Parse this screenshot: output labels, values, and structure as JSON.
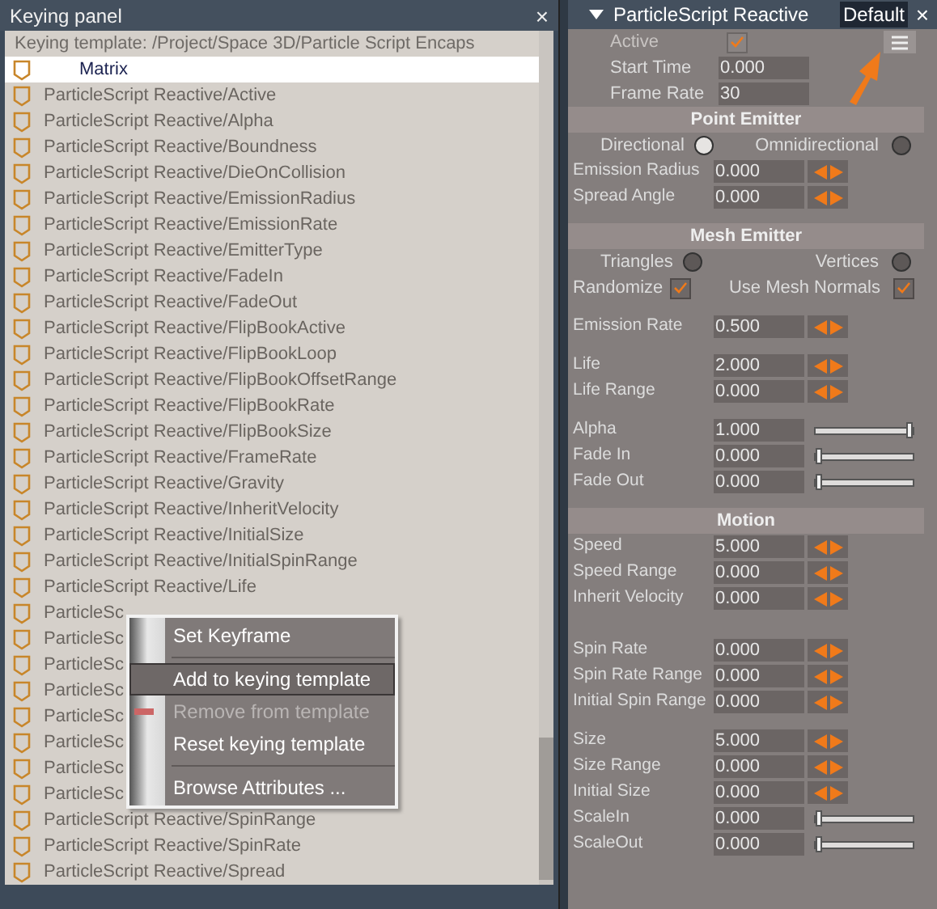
{
  "keying_panel": {
    "title": "Keying panel",
    "close": "×",
    "template": "Keying template: /Project/Space 3D/Particle Script Encaps",
    "rows": [
      {
        "label": "Matrix",
        "selected": true
      },
      {
        "label": "ParticleScript Reactive/Active",
        "selected": false
      },
      {
        "label": "ParticleScript Reactive/Alpha",
        "selected": false
      },
      {
        "label": "ParticleScript Reactive/Boundness",
        "selected": false
      },
      {
        "label": "ParticleScript Reactive/DieOnCollision",
        "selected": false
      },
      {
        "label": "ParticleScript Reactive/EmissionRadius",
        "selected": false
      },
      {
        "label": "ParticleScript Reactive/EmissionRate",
        "selected": false
      },
      {
        "label": "ParticleScript Reactive/EmitterType",
        "selected": false
      },
      {
        "label": "ParticleScript Reactive/FadeIn",
        "selected": false
      },
      {
        "label": "ParticleScript Reactive/FadeOut",
        "selected": false
      },
      {
        "label": "ParticleScript Reactive/FlipBookActive",
        "selected": false
      },
      {
        "label": "ParticleScript Reactive/FlipBookLoop",
        "selected": false
      },
      {
        "label": "ParticleScript Reactive/FlipBookOffsetRange",
        "selected": false
      },
      {
        "label": "ParticleScript Reactive/FlipBookRate",
        "selected": false
      },
      {
        "label": "ParticleScript Reactive/FlipBookSize",
        "selected": false
      },
      {
        "label": "ParticleScript Reactive/FrameRate",
        "selected": false
      },
      {
        "label": "ParticleScript Reactive/Gravity",
        "selected": false
      },
      {
        "label": "ParticleScript Reactive/InheritVelocity",
        "selected": false
      },
      {
        "label": "ParticleScript Reactive/InitialSize",
        "selected": false
      },
      {
        "label": "ParticleScript Reactive/InitialSpinRange",
        "selected": false
      },
      {
        "label": "ParticleScript Reactive/Life",
        "selected": false
      },
      {
        "label": "ParticleSc",
        "selected": false
      },
      {
        "label": "ParticleSc",
        "selected": false
      },
      {
        "label": "ParticleSc",
        "selected": false
      },
      {
        "label": "ParticleSc",
        "selected": false
      },
      {
        "label": "ParticleSc",
        "selected": false
      },
      {
        "label": "ParticleSc",
        "selected": false
      },
      {
        "label": "ParticleSc",
        "selected": false
      },
      {
        "label": "ParticleSc",
        "selected": false
      },
      {
        "label": "ParticleScript Reactive/SpinRange",
        "selected": false
      },
      {
        "label": "ParticleScript Reactive/SpinRate",
        "selected": false
      },
      {
        "label": "ParticleScript Reactive/Spread",
        "selected": false
      }
    ],
    "context_menu": [
      {
        "kind": "item",
        "label": "Set Keyframe",
        "selected": false,
        "disabled": false
      },
      {
        "kind": "separator"
      },
      {
        "kind": "item",
        "label": "Add to keying template",
        "selected": true,
        "disabled": false
      },
      {
        "kind": "item",
        "label": "Remove from template",
        "selected": false,
        "disabled": true
      },
      {
        "kind": "item",
        "label": "Reset keying template",
        "selected": false,
        "disabled": false
      },
      {
        "kind": "separator"
      },
      {
        "kind": "item",
        "label": "Browse Attributes ...",
        "selected": false,
        "disabled": false
      }
    ]
  },
  "inspector": {
    "title": "ParticleScript Reactive",
    "preset": "Default",
    "close": "×",
    "rows": [
      {
        "kind": "checkbox",
        "label": "Active",
        "checked": true,
        "disabled": true
      },
      {
        "kind": "top-field",
        "label": "Start Time",
        "value": "0.000"
      },
      {
        "kind": "top-field",
        "label": "Frame Rate",
        "value": "30"
      },
      {
        "kind": "header",
        "label": "Point Emitter"
      },
      {
        "kind": "radio-pair",
        "left": {
          "label": "Directional",
          "selected": true
        },
        "right": {
          "label": "Omnidirectional",
          "selected": false
        }
      },
      {
        "kind": "arrows",
        "label": "Emission Radius",
        "value": "0.000"
      },
      {
        "kind": "arrows",
        "label": "Spread Angle",
        "value": "0.000"
      },
      {
        "kind": "gap"
      },
      {
        "kind": "header",
        "label": "Mesh Emitter"
      },
      {
        "kind": "radio-pair",
        "left": {
          "label": "Triangles",
          "selected": false
        },
        "right": {
          "label": "Vertices",
          "selected": false
        }
      },
      {
        "kind": "check-pair",
        "left": {
          "label": "Randomize",
          "checked": true
        },
        "right": {
          "label": "Use Mesh Normals",
          "checked": true
        }
      },
      {
        "kind": "gap"
      },
      {
        "kind": "arrows",
        "label": "Emission Rate",
        "value": "0.500"
      },
      {
        "kind": "gap"
      },
      {
        "kind": "arrows",
        "label": "Life",
        "value": "2.000"
      },
      {
        "kind": "arrows",
        "label": "Life Range",
        "value": "0.000"
      },
      {
        "kind": "gap"
      },
      {
        "kind": "slider",
        "label": "Alpha",
        "value": "1.000",
        "level": 1
      },
      {
        "kind": "slider",
        "label": "Fade In",
        "value": "0.000",
        "level": 0
      },
      {
        "kind": "slider",
        "label": "Fade Out",
        "value": "0.000",
        "level": 0
      },
      {
        "kind": "gap"
      },
      {
        "kind": "header",
        "label": "Motion"
      },
      {
        "kind": "arrows",
        "label": "Speed",
        "value": "5.000"
      },
      {
        "kind": "arrows",
        "label": "Speed Range",
        "value": "0.000"
      },
      {
        "kind": "arrows",
        "label": "Inherit Velocity",
        "value": "0.000"
      },
      {
        "kind": "gap"
      },
      {
        "kind": "gap"
      },
      {
        "kind": "arrows",
        "label": "Spin Rate",
        "value": "0.000"
      },
      {
        "kind": "arrows",
        "label": "Spin Rate Range",
        "value": "0.000"
      },
      {
        "kind": "arrows",
        "label": "Initial Spin Range",
        "value": "0.000"
      },
      {
        "kind": "gap"
      },
      {
        "kind": "arrows",
        "label": "Size",
        "value": "5.000"
      },
      {
        "kind": "arrows",
        "label": "Size Range",
        "value": "0.000"
      },
      {
        "kind": "arrows",
        "label": "Initial Size",
        "value": "0.000"
      },
      {
        "kind": "slider",
        "label": "ScaleIn",
        "value": "0.000",
        "level": 0
      },
      {
        "kind": "slider",
        "label": "ScaleOut",
        "value": "0.000",
        "level": 0
      }
    ]
  }
}
